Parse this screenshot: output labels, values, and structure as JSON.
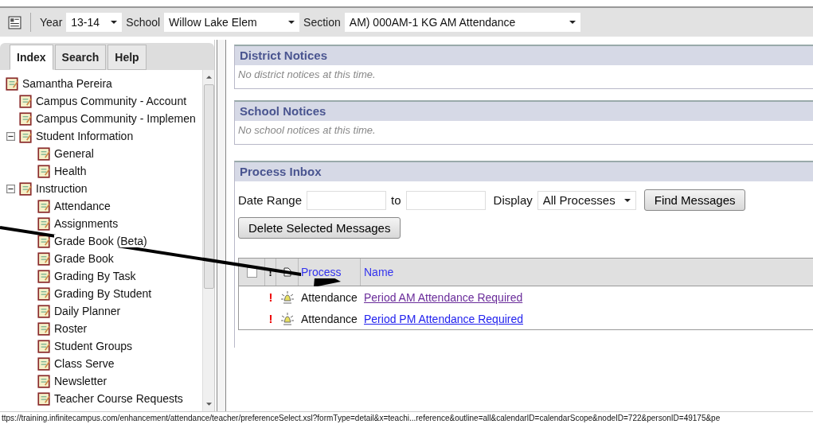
{
  "toolbar": {
    "year": {
      "label": "Year",
      "value": "13-14"
    },
    "school": {
      "label": "School",
      "value": "Willow Lake Elem"
    },
    "section": {
      "label": "Section",
      "value": "AM) 000AM-1 KG AM Attendance"
    }
  },
  "tabs": [
    {
      "label": "Index",
      "selected": true
    },
    {
      "label": "Search",
      "selected": false
    },
    {
      "label": "Help",
      "selected": false
    }
  ],
  "tree": [
    {
      "label": "Samantha Pereira",
      "children": [
        {
          "label": "Campus Community - Account"
        },
        {
          "label": "Campus Community - Implemen"
        },
        {
          "label": "Student Information",
          "expanded": true,
          "children": [
            {
              "label": "General"
            },
            {
              "label": "Health"
            }
          ]
        },
        {
          "label": "Instruction",
          "expanded": true,
          "children": [
            {
              "label": "Attendance"
            },
            {
              "label": "Assignments"
            },
            {
              "label": "Grade Book (Beta)"
            },
            {
              "label": "Grade Book"
            },
            {
              "label": "Grading By Task"
            },
            {
              "label": "Grading By Student"
            },
            {
              "label": "Daily Planner"
            },
            {
              "label": "Roster"
            },
            {
              "label": "Student Groups"
            },
            {
              "label": "Class Serve"
            },
            {
              "label": "Newsletter"
            },
            {
              "label": "Teacher Course Requests"
            }
          ]
        }
      ]
    }
  ],
  "district_notices": {
    "title": "District Notices",
    "text": "No district notices at this time."
  },
  "school_notices": {
    "title": "School Notices",
    "text": "No school notices at this time."
  },
  "process_inbox": {
    "title": "Process Inbox",
    "date_range_label": "Date Range",
    "to_label": "to",
    "display_label": "Display",
    "display_value": "All Processes",
    "find_button": "Find Messages",
    "delete_button": "Delete Selected Messages",
    "columns": {
      "select_all_checked": false,
      "priority": "!",
      "process": "Process",
      "name": "Name"
    },
    "rows": [
      {
        "priority": "!",
        "process": "Attendance",
        "name": "Period AM Attendance Required",
        "visited": true
      },
      {
        "priority": "!",
        "process": "Attendance",
        "name": "Period PM Attendance Required",
        "visited": false
      }
    ]
  },
  "status_bar": "ttps://training.infinitecampus.com/enhancement/attendance/teacher/preferenceSelect.xsl?formType=detail&x=teachi...reference&outline=all&calendarID=calendarScope&nodeID=722&personID=49175&pe"
}
